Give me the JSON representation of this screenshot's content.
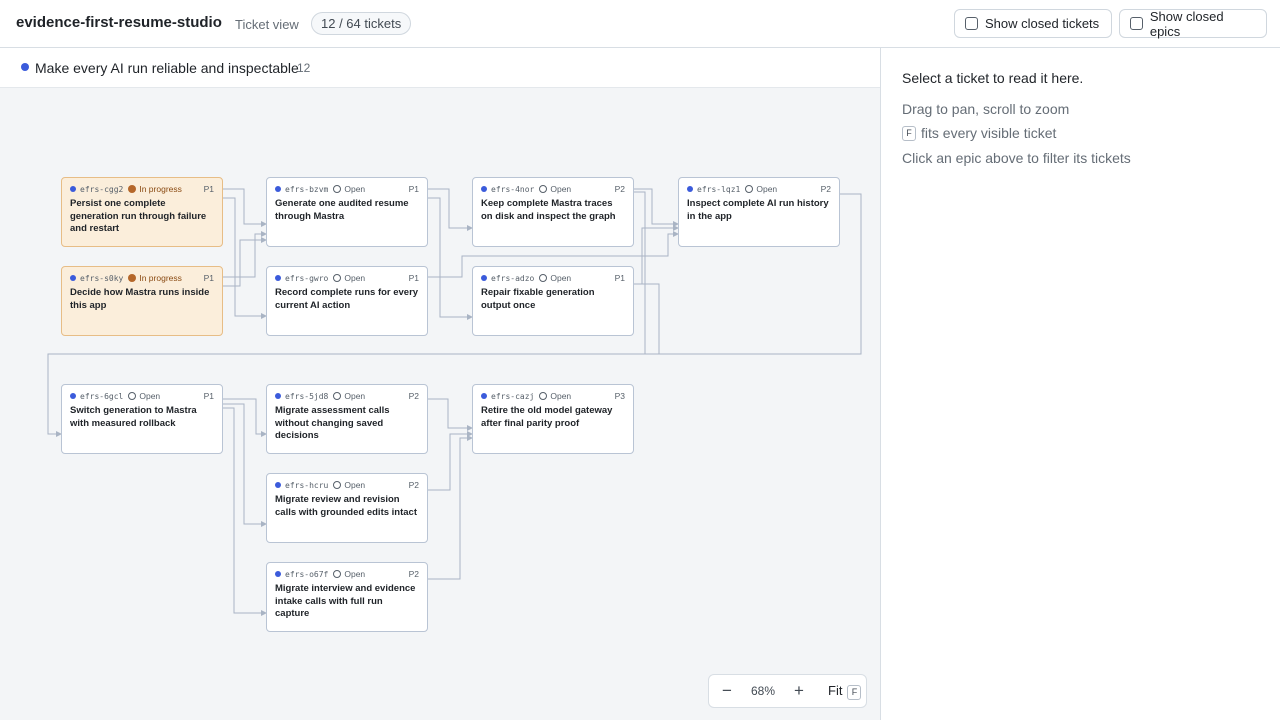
{
  "header": {
    "app_title": "evidence-first-resume-studio",
    "view_label": "Ticket view",
    "ticket_count": "12 / 64 tickets",
    "show_closed_tickets": "Show closed tickets",
    "show_closed_epics": "Show closed epics"
  },
  "epic": {
    "name": "Make every AI run reliable and inspectable",
    "count": "12",
    "color": "#3b5bdb"
  },
  "tickets": [
    {
      "id": "efrs-cgg2",
      "status": "In progress",
      "priority": "P1",
      "title": "Persist one complete generation run through failure and restart"
    },
    {
      "id": "efrs-s0ky",
      "status": "In progress",
      "priority": "P1",
      "title": "Decide how Mastra runs inside this app"
    },
    {
      "id": "efrs-bzvm",
      "status": "Open",
      "priority": "P1",
      "title": "Generate one audited resume through Mastra"
    },
    {
      "id": "efrs-gwro",
      "status": "Open",
      "priority": "P1",
      "title": "Record complete runs for every current AI action"
    },
    {
      "id": "efrs-4nor",
      "status": "Open",
      "priority": "P2",
      "title": "Keep complete Mastra traces on disk and inspect the graph"
    },
    {
      "id": "efrs-adzo",
      "status": "Open",
      "priority": "P1",
      "title": "Repair fixable generation output once"
    },
    {
      "id": "efrs-lqz1",
      "status": "Open",
      "priority": "P2",
      "title": "Inspect complete AI run history in the app"
    },
    {
      "id": "efrs-6gcl",
      "status": "Open",
      "priority": "P1",
      "title": "Switch generation to Mastra with measured rollback"
    },
    {
      "id": "efrs-5jd8",
      "status": "Open",
      "priority": "P2",
      "title": "Migrate assessment calls without changing saved decisions"
    },
    {
      "id": "efrs-hcru",
      "status": "Open",
      "priority": "P2",
      "title": "Migrate review and revision calls with grounded edits intact"
    },
    {
      "id": "efrs-o67f",
      "status": "Open",
      "priority": "P2",
      "title": "Migrate interview and evidence intake calls with full run capture"
    },
    {
      "id": "efrs-cazj",
      "status": "Open",
      "priority": "P3",
      "title": "Retire the old model gateway after final parity proof"
    }
  ],
  "zoom": {
    "zoom_out_icon": "minus-icon",
    "zoom_in_icon": "plus-icon",
    "zoom_out_glyph": "−",
    "zoom_in_glyph": "+",
    "level": "68%",
    "fit_label": "Fit",
    "fit_key": "F"
  },
  "panel": {
    "lead": "Select a ticket to read it here.",
    "hint_pan": "Drag to pan, scroll to zoom",
    "hint_fit_key": "F",
    "hint_fit": "fits every visible ticket",
    "hint_filter": "Click an epic above to filter its tickets"
  }
}
